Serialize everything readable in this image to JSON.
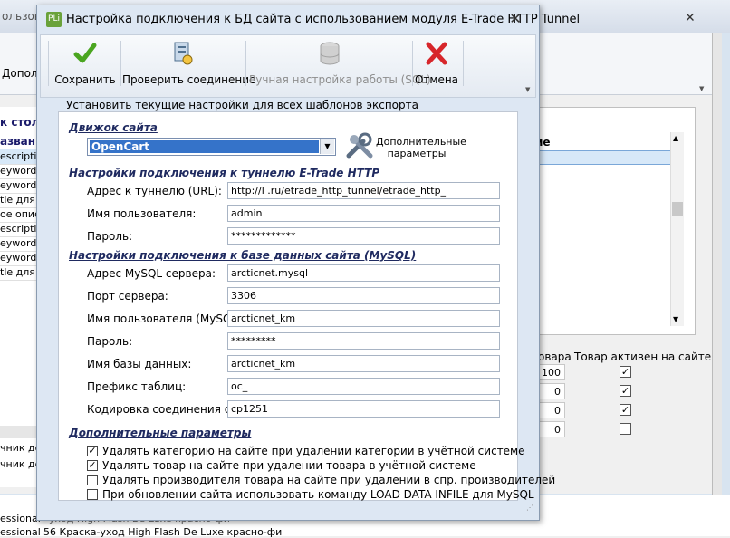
{
  "background_window": {
    "title_fragment": "ользоват",
    "toolbar_label": "Допол",
    "left_list": {
      "header_1": "к столб",
      "header_2": "азвани",
      "rows": [
        "escription",
        "eywords",
        "eywords",
        "tle для к",
        "ое описа",
        "escription",
        "eywords",
        "eywords",
        "tle для т"
      ]
    },
    "left_bottom_rows": [
      "чник до",
      "чник до"
    ],
    "right_panel": {
      "column_header": "ие",
      "table_headers": [
        "овара",
        "Товар активен на сайте"
      ],
      "rows": [
        {
          "count": "100",
          "active": true
        },
        {
          "count": "0",
          "active": true
        },
        {
          "count": "0",
          "active": true
        },
        {
          "count": "0",
          "active": false
        }
      ]
    },
    "bottom_rows": [
      {
        "left": "essional",
        "right": "-уход High Flash Be Luxe красно-фи"
      },
      {
        "left": "essional",
        "right": "56 Краска-уход High Flash De Luxe красно-фи"
      }
    ]
  },
  "dialog": {
    "icon_text": "PLi",
    "title": "Настройка подключения к БД сайта с использованием модуля E-Trade HTTP Tunnel",
    "toolbar": {
      "save": "Сохранить",
      "test": "Проверить соединение",
      "manual": "Ручная настройка работы (SQL)",
      "cancel": "Отмена"
    },
    "apply_all": "Установить текущие настройки для всех шаблонов экспорта",
    "engine": {
      "section": "Движок сайта",
      "value": "OpenCart",
      "extra_params": "Дополнительные\nпараметры"
    },
    "tunnel": {
      "section": "Настройки подключения к туннелю E-Trade HTTP",
      "url_label": "Адрес к туннелю (URL):",
      "url_value": "http://l                              .ru/etrade_http_tunnel/etrade_http_",
      "user_label": "Имя пользователя:",
      "user_value": "admin",
      "pass_label": "Пароль:",
      "pass_value": "*************"
    },
    "mysql": {
      "section": "Настройки подключения к базе данных сайта (MySQL)",
      "server_label": "Адрес MySQL сервера:",
      "server_value": "arcticnet.mysql",
      "port_label": "Порт сервера:",
      "port_value": "3306",
      "user_label": "Имя пользователя (MySQL):",
      "user_value": "arcticnet_km",
      "pass_label": "Пароль:",
      "pass_value": "*********",
      "db_label": "Имя базы данных:",
      "db_value": "arcticnet_km",
      "prefix_label": "Префикс таблиц:",
      "prefix_value": "oc_",
      "encoding_label": "Кодировка соединения с БД:",
      "encoding_value": "cp1251"
    },
    "extra": {
      "section": "Дополнительные параметры",
      "options": [
        {
          "label": "Удалять категорию на сайте при удалении категории в учётной системе",
          "checked": true
        },
        {
          "label": "Удалять товар на сайте при удалении товара в учётной системе",
          "checked": true
        },
        {
          "label": "Удалять производителя товара на сайте при удалении в спр. производителей",
          "checked": false
        },
        {
          "label": "При обновлении сайта использовать команду LOAD DATA INFILE для MySQL",
          "checked": false
        }
      ]
    }
  },
  "colors": {
    "accent": "#3573c9",
    "section_text": "#1f2a60",
    "save_green": "#4aa520",
    "cancel_red": "#d7262b"
  }
}
